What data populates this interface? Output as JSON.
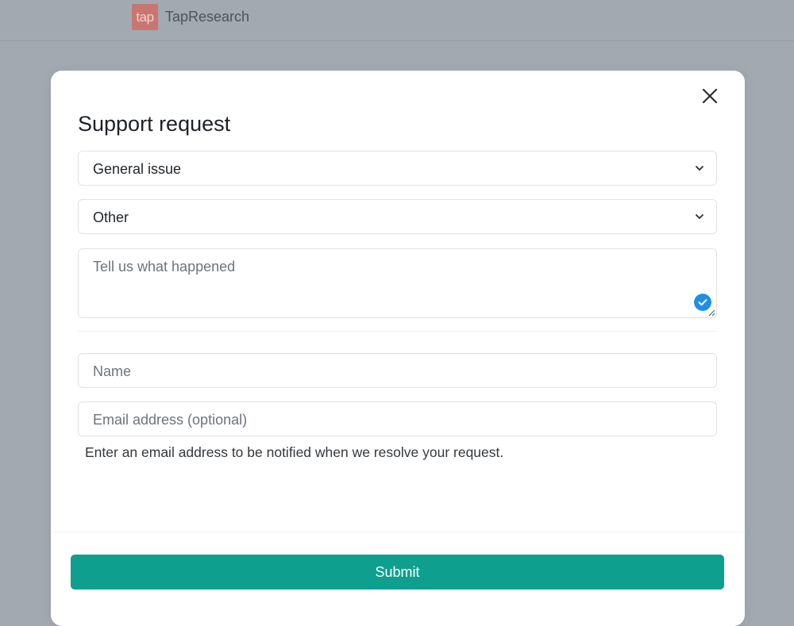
{
  "header": {
    "logo_text": "tap",
    "brand_name": "TapResearch"
  },
  "modal": {
    "title": "Support request",
    "category_select": {
      "value": "General issue"
    },
    "subcategory_select": {
      "value": "Other"
    },
    "description": {
      "placeholder": "Tell us what happened",
      "value": ""
    },
    "name_field": {
      "placeholder": "Name",
      "value": ""
    },
    "email_field": {
      "placeholder": "Email address (optional)",
      "value": ""
    },
    "email_helper": "Enter an email address to be notified when we resolve your request.",
    "submit_label": "Submit"
  },
  "icons": {
    "close": "close-icon",
    "chevron": "chevron-down-icon",
    "check": "check-circle-icon",
    "resize": "resize-handle-icon"
  },
  "colors": {
    "accent": "#0e9f8e",
    "check": "#1e8ee8",
    "logo_bg": "#c9766f",
    "backdrop": "#a3a9b1"
  }
}
